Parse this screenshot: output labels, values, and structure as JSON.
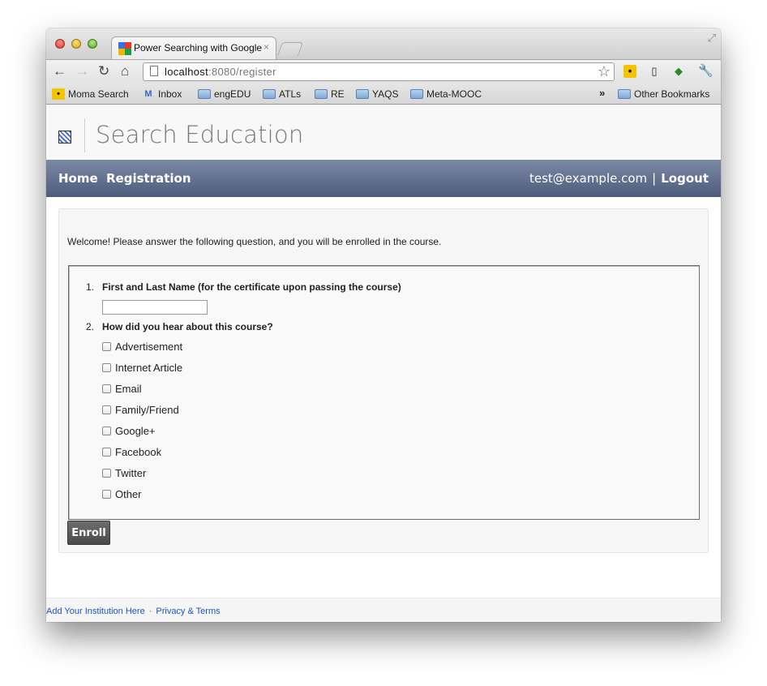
{
  "browser": {
    "tab_title": "Power Searching with Google",
    "tab_close": "×",
    "url_host": "localhost",
    "url_rest": ":8080/register",
    "star_icon": "☆"
  },
  "bookmarks": {
    "items": [
      {
        "label": "Moma Search",
        "icon": "moma-icon"
      },
      {
        "label": "Inbox",
        "icon": "gmail-icon"
      },
      {
        "label": "engEDU",
        "icon": "folder-icon"
      },
      {
        "label": "ATLs",
        "icon": "folder-icon"
      },
      {
        "label": "RE",
        "icon": "folder-icon"
      },
      {
        "label": "YAQS",
        "icon": "folder-icon"
      },
      {
        "label": "Meta-MOOC",
        "icon": "folder-icon"
      }
    ],
    "chevron": "»",
    "other": "Other Bookmarks"
  },
  "site": {
    "title": "Search Education"
  },
  "nav": {
    "home": "Home",
    "registration": "Registration",
    "user_email": "test@example.com",
    "separator": "|",
    "logout": "Logout"
  },
  "form": {
    "welcome": "Welcome! Please answer the following question, and you will be enrolled in the course.",
    "q1_num": "1.",
    "q1_label": "First and Last Name (for the certificate upon passing the course)",
    "q1_value": "",
    "q2_num": "2.",
    "q2_label": "How did you hear about this course?",
    "options": [
      "Advertisement",
      "Internet Article",
      "Email",
      "Family/Friend",
      "Google+",
      "Facebook",
      "Twitter",
      "Other"
    ],
    "enroll_label": "Enroll"
  },
  "footer": {
    "institution": "Add Your Institution Here",
    "dot": "·",
    "privacy": "Privacy & Terms"
  },
  "colors": {
    "navbar": "#5f6d8c",
    "link": "#1a56c4"
  }
}
